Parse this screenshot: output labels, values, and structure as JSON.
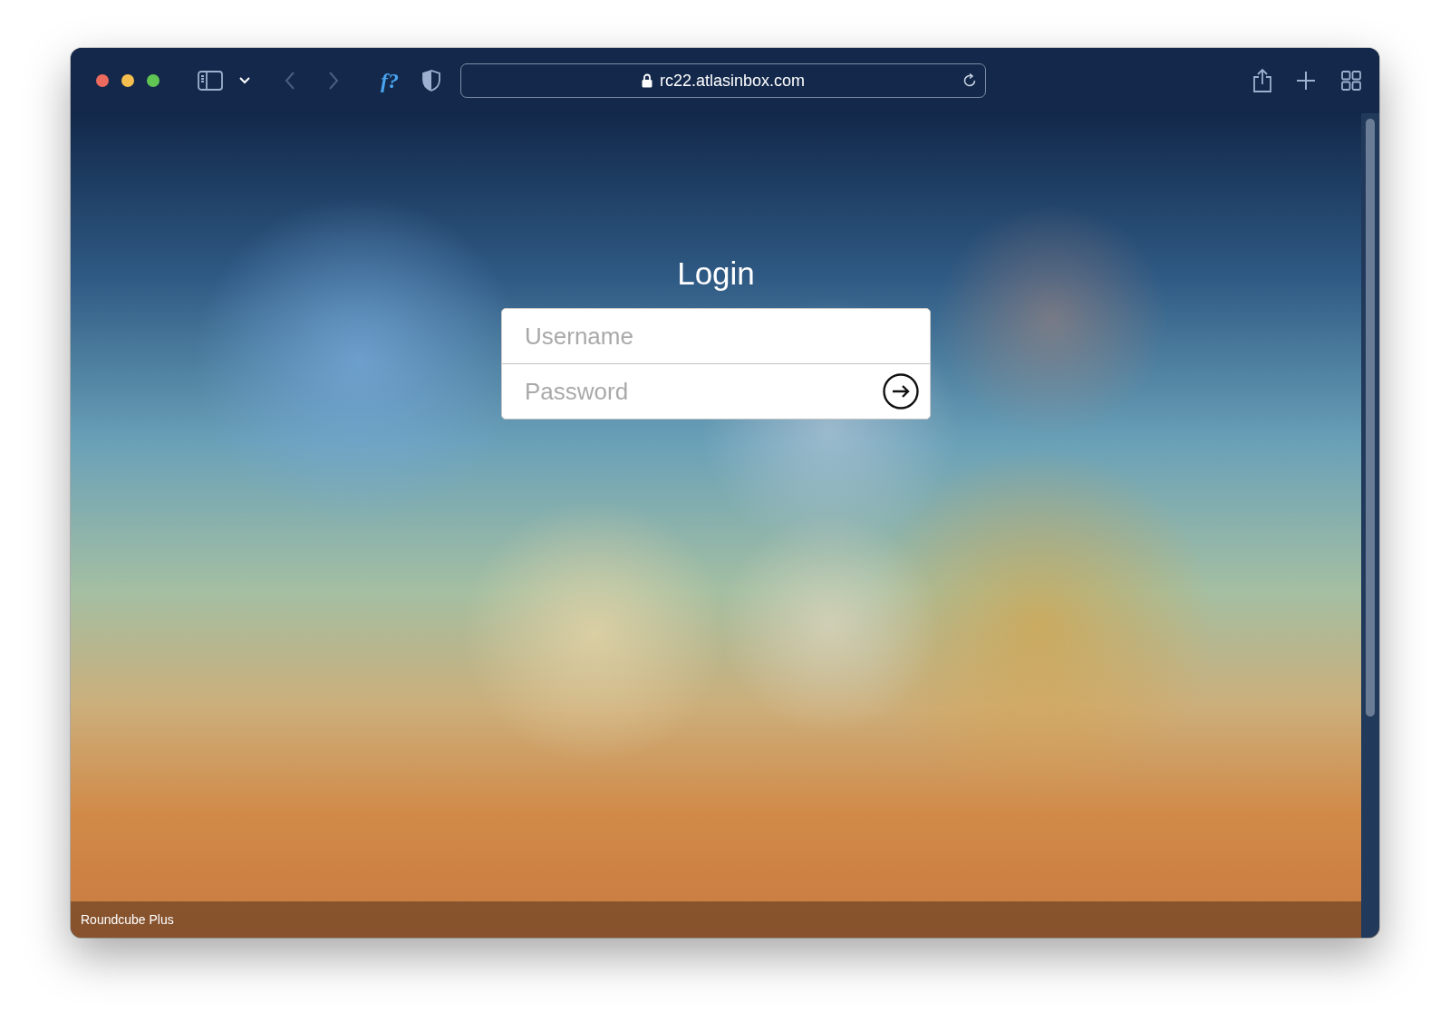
{
  "browser": {
    "extension_label": "f?",
    "url": "rc22.atlasinbox.com",
    "secure": true
  },
  "login": {
    "title": "Login",
    "username": {
      "placeholder": "Username"
    },
    "password": {
      "placeholder": "Password"
    }
  },
  "footer": {
    "brand": "Roundcube Plus"
  }
}
